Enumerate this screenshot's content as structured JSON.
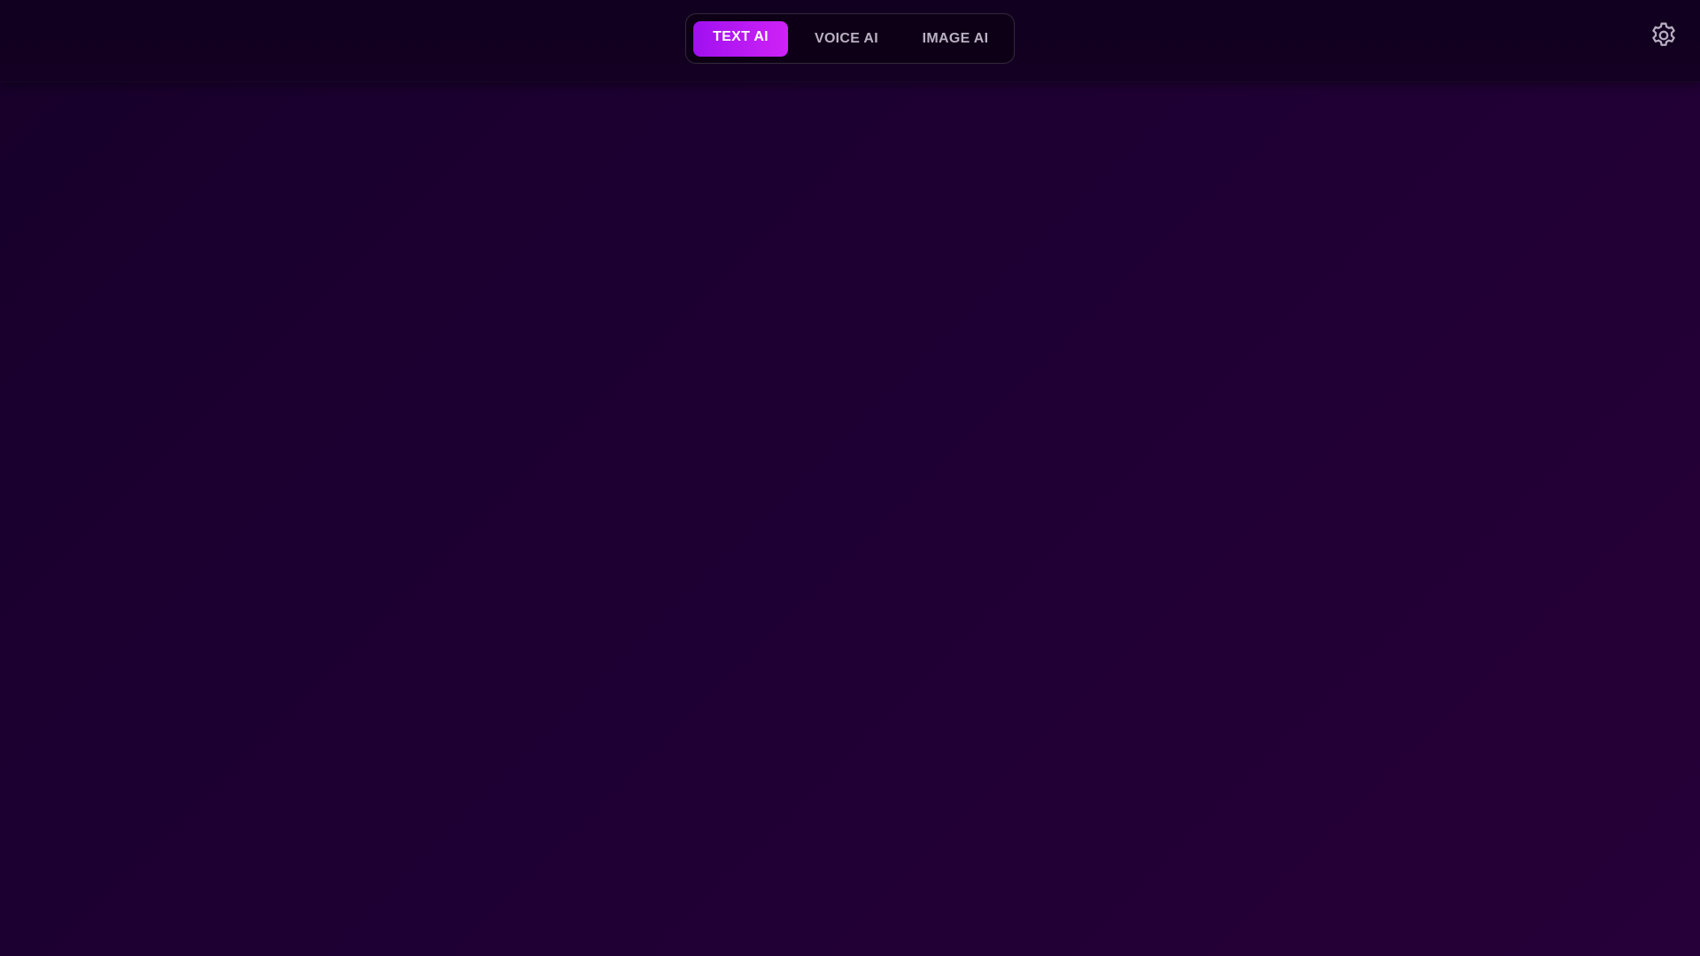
{
  "tabs": {
    "text_ai": "TEXT AI",
    "voice_ai": "VOICE AI",
    "image_ai": "IMAGE AI",
    "active": "text_ai"
  },
  "settings": {
    "icon": "gear-icon"
  },
  "colors": {
    "accent_start": "#a010f0",
    "accent_end": "#cf22f6",
    "background": "#1d0032",
    "topbar": "#12001f"
  }
}
